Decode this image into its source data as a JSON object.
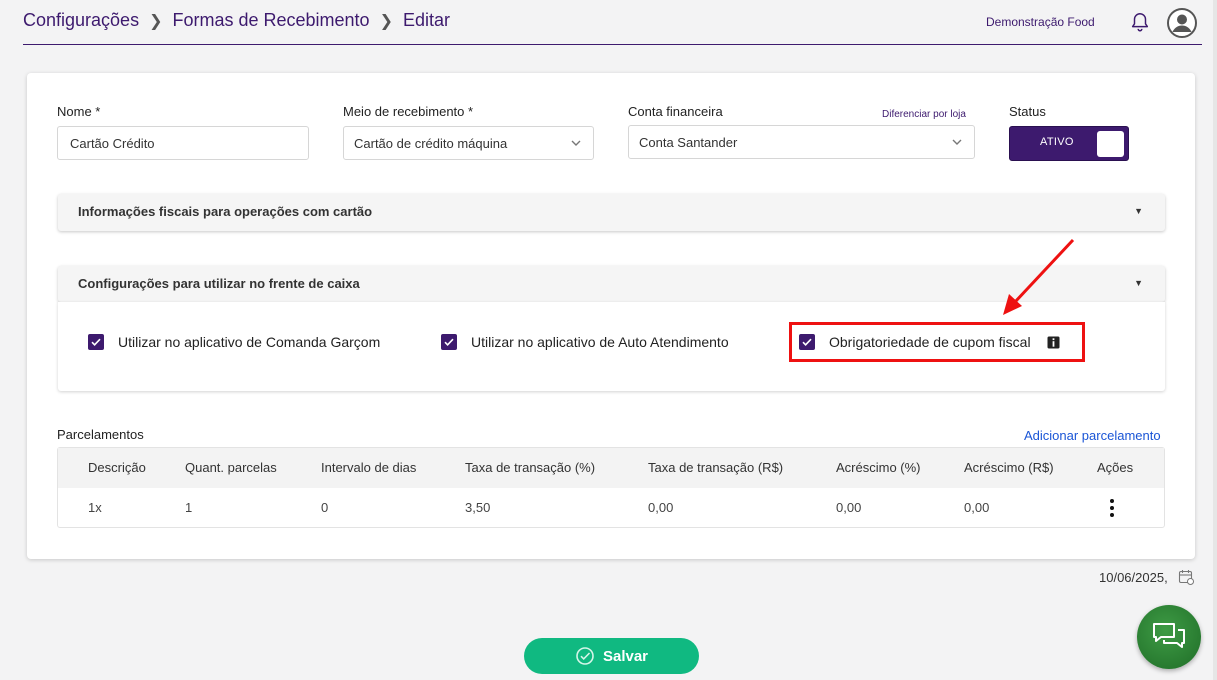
{
  "breadcrumb": {
    "level1": "Configurações",
    "level2": "Formas de Recebimento",
    "level3": "Editar"
  },
  "header": {
    "company": "Demonstração Food"
  },
  "form": {
    "nome_label": "Nome *",
    "nome_value": "Cartão Crédito",
    "meio_label": "Meio de recebimento *",
    "meio_value": "Cartão de crédito máquina",
    "conta_label": "Conta financeira",
    "conta_value": "Conta Santander",
    "diferenciar_link": "Diferenciar por loja",
    "status_label": "Status",
    "status_value": "ATIVO"
  },
  "sections": {
    "fiscal_title": "Informações fiscais para operações com cartão",
    "frente_title": "Configurações para utilizar no frente de caixa",
    "options": [
      {
        "label": "Utilizar no aplicativo de Comanda Garçom",
        "checked": true
      },
      {
        "label": "Utilizar no aplicativo de Auto Atendimento",
        "checked": true
      },
      {
        "label": "Obrigatoriedade de cupom fiscal",
        "checked": true
      }
    ]
  },
  "parcelamentos": {
    "title": "Parcelamentos",
    "add_link": "Adicionar parcelamento",
    "columns": [
      "Descrição",
      "Quant. parcelas",
      "Intervalo de dias",
      "Taxa de transação (%)",
      "Taxa de transação (R$)",
      "Acréscimo (%)",
      "Acréscimo (R$)",
      "Ações"
    ],
    "rows": [
      [
        "1x",
        "1",
        "0",
        "3,50",
        "0,00",
        "0,00",
        "0,00"
      ]
    ]
  },
  "footer": {
    "date": "10/06/2025,",
    "save_label": "Salvar"
  },
  "colors": {
    "primary": "#3d1a6e",
    "accent_green": "#10b981",
    "highlight_red": "#ee1111",
    "link_blue": "#1a55d6"
  },
  "icons": [
    "bell-icon",
    "avatar-icon",
    "chevron-down-icon",
    "check-icon",
    "info-icon",
    "kebab-menu-icon",
    "calendar-icon",
    "chat-icon",
    "check-circle-icon"
  ]
}
